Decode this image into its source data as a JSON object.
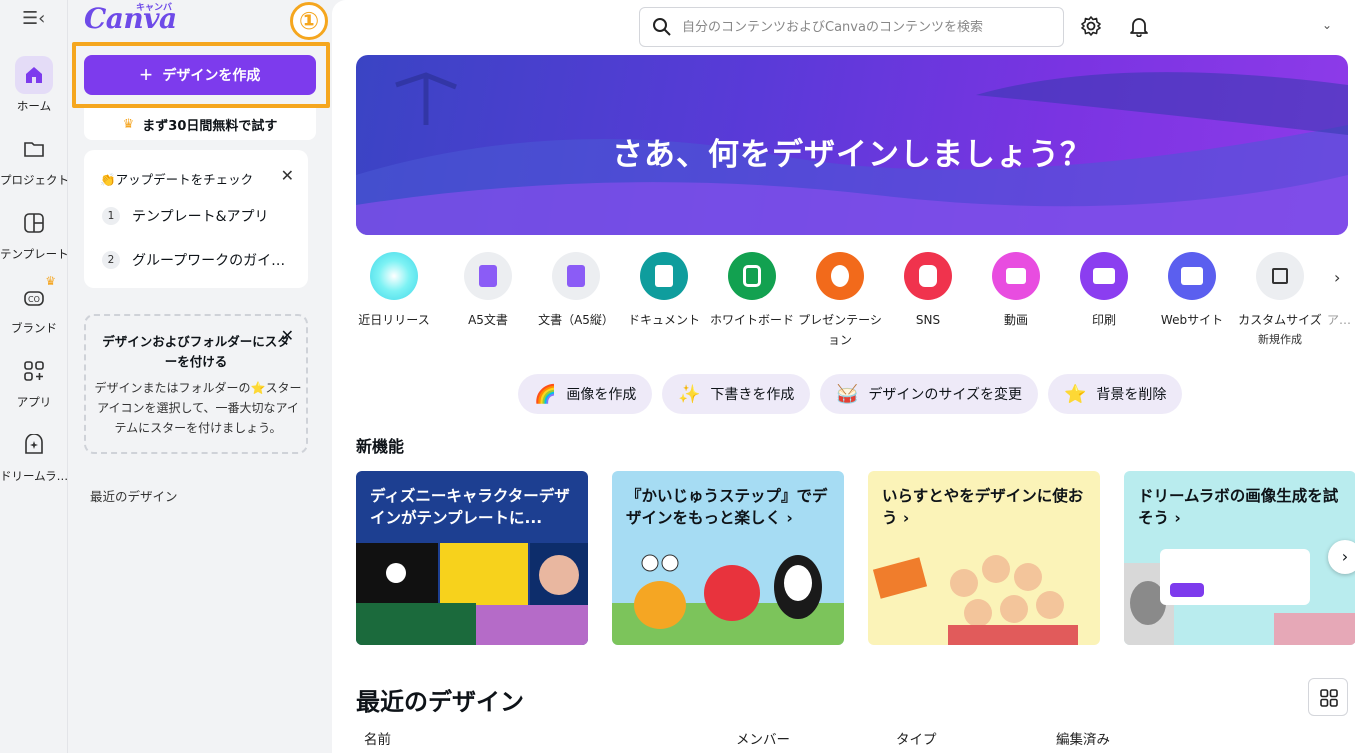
{
  "rail": {
    "items": [
      {
        "label": "ホーム",
        "icon": "home-icon"
      },
      {
        "label": "プロジェクト",
        "icon": "folder-icon"
      },
      {
        "label": "テンプレート",
        "icon": "template-icon"
      },
      {
        "label": "ブランド",
        "icon": "brand-icon"
      },
      {
        "label": "アプリ",
        "icon": "apps-icon"
      },
      {
        "label": "ドリームラ…",
        "icon": "dream-lab-icon"
      }
    ]
  },
  "panel": {
    "logo": "Canva",
    "logo_kana": "キャンバ",
    "step_marker": "①",
    "create_label": "デザインを作成",
    "trial_label": "まず30日間無料で試す",
    "updates": {
      "title": "👏アップデートをチェック",
      "items": [
        {
          "num": "1",
          "label": "テンプレート&アプリ"
        },
        {
          "num": "2",
          "label": "グループワークのガイ…"
        }
      ]
    },
    "star_card": {
      "title": "デザインおよびフォルダーにスターを付ける",
      "body": "デザインまたはフォルダーの⭐スターアイコンを選択して、一番大切なアイテムにスターを付けましょう。"
    },
    "recent_label": "最近のデザイン"
  },
  "header": {
    "search_placeholder": "自分のコンテンツおよびCanvaのコンテンツを検索"
  },
  "hero": {
    "title": "さあ、何をデザインしましょう？"
  },
  "design_types": [
    {
      "label": "近日リリース",
      "sub": "",
      "color": "#5fe8f0"
    },
    {
      "label": "A5文書",
      "sub": "",
      "color": "#8b5cf6"
    },
    {
      "label": "文書（A5縦）",
      "sub": "",
      "color": "#8b5cf6"
    },
    {
      "label": "ドキュメント",
      "sub": "",
      "color": "#0f9d9d"
    },
    {
      "label": "ホワイトボード",
      "sub": "",
      "color": "#12a150"
    },
    {
      "label": "プレゼンテーション",
      "sub": "",
      "color": "#f26a1b"
    },
    {
      "label": "SNS",
      "sub": "",
      "color": "#f0334d"
    },
    {
      "label": "動画",
      "sub": "",
      "color": "#e84de0"
    },
    {
      "label": "印刷",
      "sub": "",
      "color": "#8b3ef0"
    },
    {
      "label": "Webサイト",
      "sub": "",
      "color": "#5b5fef"
    },
    {
      "label": "カスタムサイズ",
      "sub": "新規作成",
      "color": "#eceef1"
    },
    {
      "label": "ア…",
      "sub": "",
      "color": "#ffffff"
    }
  ],
  "chips": [
    {
      "label": "画像を作成",
      "glyph": "🌈"
    },
    {
      "label": "下書きを作成",
      "glyph": "✨"
    },
    {
      "label": "デザインのサイズを変更",
      "glyph": "🥁"
    },
    {
      "label": "背景を削除",
      "glyph": "⭐"
    }
  ],
  "features": {
    "title": "新機能",
    "cards": [
      {
        "title": "ディズニーキャラクターデザインがテンプレートに...",
        "bg": "#1d3f91",
        "fg": "#ffffff"
      },
      {
        "title": "『かいじゅうステップ』でデザインをもっと楽しく ›",
        "bg": "#a6dcf3",
        "fg": "#0e1318"
      },
      {
        "title": "いらすとやをデザインに使おう ›",
        "bg": "#fbf3b8",
        "fg": "#0e1318"
      },
      {
        "title": "ドリームラボの画像生成を試そう ›",
        "bg": "#b9ecee",
        "fg": "#0e1318"
      }
    ]
  },
  "recent": {
    "title": "最近のデザイン",
    "columns": [
      "名前",
      "メンバー",
      "タイプ",
      "編集済み"
    ]
  }
}
